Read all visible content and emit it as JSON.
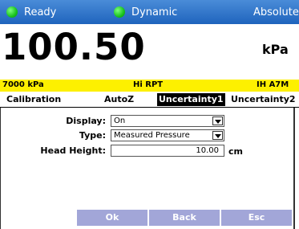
{
  "status": {
    "ready_label": "Ready",
    "dynamic_label": "Dynamic",
    "absolute_label": "Absolute"
  },
  "reading": {
    "value": "100.50",
    "unit": "kPa"
  },
  "info": {
    "range": "7000 kPa",
    "module": "Hi RPT",
    "id": "IH A7M"
  },
  "tabs": [
    {
      "label": "Calibration",
      "active": false
    },
    {
      "label": "AutoZ",
      "active": false
    },
    {
      "label": "Uncertainty1",
      "active": true
    },
    {
      "label": "Uncertainty2",
      "active": false
    }
  ],
  "form": {
    "display_label": "Display:",
    "display_value": "On",
    "type_label": "Type:",
    "type_value": "Measured Pressure",
    "head_label": "Head Height:",
    "head_value": "10.00",
    "head_unit": "cm"
  },
  "buttons": {
    "ok": "Ok",
    "back": "Back",
    "esc": "Esc"
  },
  "colors": {
    "status_bar": "#2f74c9",
    "info_bar": "#fdf000",
    "button": "#a2a6d8",
    "led": "#18c21c"
  }
}
